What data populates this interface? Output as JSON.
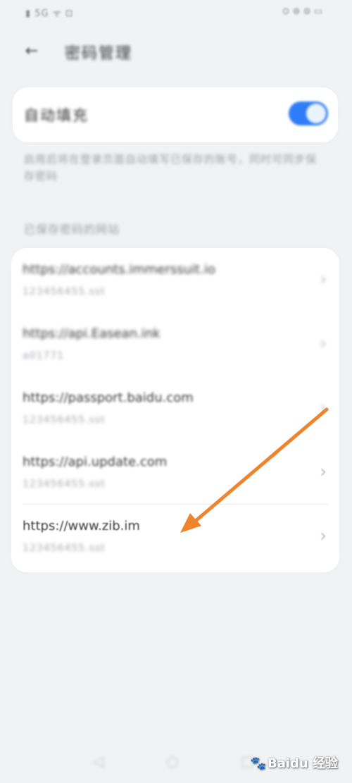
{
  "status_bar": {
    "left": "▮ 5G ᯤ ⊡",
    "right": "⊙ ⊛ ⊜ ▭"
  },
  "header": {
    "back_icon": "arrow-left-icon",
    "title": "密码管理"
  },
  "toggle_card": {
    "label": "自动填充",
    "enabled": true
  },
  "description": "启用后将在登录页面自动填写已保存的账号，同时可同步保存密码",
  "section_title": "已保存密码的网站",
  "sites": [
    {
      "url": "https://accounts.immerssuit.io",
      "detail": "123456455.sst"
    },
    {
      "url": "https://api.Easean.ink",
      "detail": "a01771"
    },
    {
      "url": "https://passport.baidu.com",
      "detail": "123456455.sst"
    },
    {
      "url": "https://api.update.com",
      "detail": "123456455.sst"
    },
    {
      "url": "https://www.zib.im",
      "detail": "123456455.sst"
    }
  ],
  "annotation": {
    "color": "#f0842c",
    "points_to": "https://www.zib.im"
  },
  "nav": {
    "back_icon": "◁",
    "home_icon": "○",
    "recent_icon": "□"
  },
  "watermark": {
    "paw": "🐾",
    "text": "Baidu 经验"
  }
}
